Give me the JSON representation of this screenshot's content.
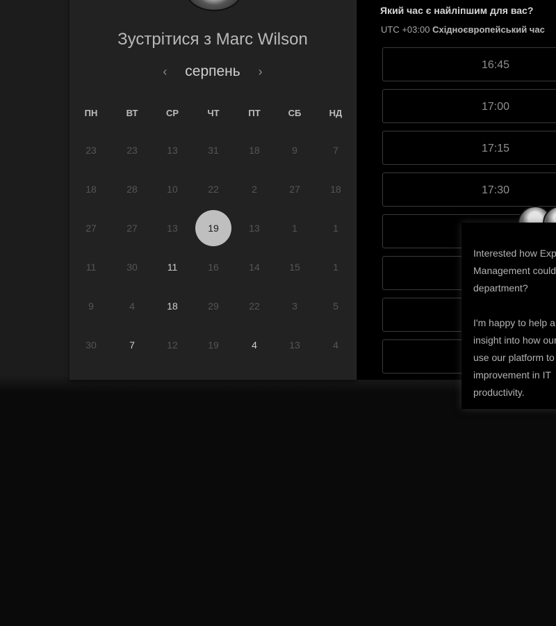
{
  "calendar": {
    "title": "Зустрітися з Marc Wilson",
    "month": "серпень",
    "prev_icon": "‹",
    "next_icon": "›",
    "weekdays": [
      "ПН",
      "ВТ",
      "СР",
      "ЧТ",
      "ПТ",
      "СБ",
      "НД"
    ],
    "weeks": [
      [
        {
          "d": "23",
          "s": "off"
        },
        {
          "d": "23",
          "s": "off"
        },
        {
          "d": "13",
          "s": "off"
        },
        {
          "d": "31",
          "s": "off"
        },
        {
          "d": "18",
          "s": "off"
        },
        {
          "d": "9",
          "s": "off"
        },
        {
          "d": "7",
          "s": "off"
        }
      ],
      [
        {
          "d": "18",
          "s": "off"
        },
        {
          "d": "28",
          "s": "off"
        },
        {
          "d": "10",
          "s": "off"
        },
        {
          "d": "22",
          "s": "off"
        },
        {
          "d": "2",
          "s": "off"
        },
        {
          "d": "27",
          "s": "off"
        },
        {
          "d": "18",
          "s": "off"
        }
      ],
      [
        {
          "d": "27",
          "s": "off"
        },
        {
          "d": "27",
          "s": "off"
        },
        {
          "d": "13",
          "s": "off"
        },
        {
          "d": "19",
          "s": "selected"
        },
        {
          "d": "13",
          "s": "off"
        },
        {
          "d": "1",
          "s": "off"
        },
        {
          "d": "1",
          "s": "off"
        }
      ],
      [
        {
          "d": "11",
          "s": "off"
        },
        {
          "d": "30",
          "s": "off"
        },
        {
          "d": "11",
          "s": "avail"
        },
        {
          "d": "16",
          "s": "off"
        },
        {
          "d": "14",
          "s": "off"
        },
        {
          "d": "15",
          "s": "off"
        },
        {
          "d": "1",
          "s": "off"
        }
      ],
      [
        {
          "d": "9",
          "s": "off"
        },
        {
          "d": "4",
          "s": "off"
        },
        {
          "d": "18",
          "s": "avail"
        },
        {
          "d": "29",
          "s": "off"
        },
        {
          "d": "22",
          "s": "off"
        },
        {
          "d": "3",
          "s": "off"
        },
        {
          "d": "5",
          "s": "off"
        }
      ],
      [
        {
          "d": "30",
          "s": "off"
        },
        {
          "d": "7",
          "s": "avail"
        },
        {
          "d": "12",
          "s": "off"
        },
        {
          "d": "19",
          "s": "off"
        },
        {
          "d": "4",
          "s": "avail"
        },
        {
          "d": "13",
          "s": "off"
        },
        {
          "d": "4",
          "s": "off"
        }
      ]
    ]
  },
  "times": {
    "question": "Який час є найліпшим для вас?",
    "tz_offset": "UTC +03:00",
    "tz_name": "Східноєвропейський час",
    "slots": [
      "16:45",
      "17:00",
      "17:15",
      "17:30",
      "",
      "",
      "",
      ""
    ]
  },
  "chat": {
    "message": "Interested how Expert\nManagement could\ndepartment?\n\nI'm happy to help a\ninsight into how our\nuse our platform to\nimprovement in IT\nproductivity."
  },
  "colors": {
    "background": "#0a0a0a",
    "card": "#222222",
    "selected_day": "#bfbfbf"
  }
}
